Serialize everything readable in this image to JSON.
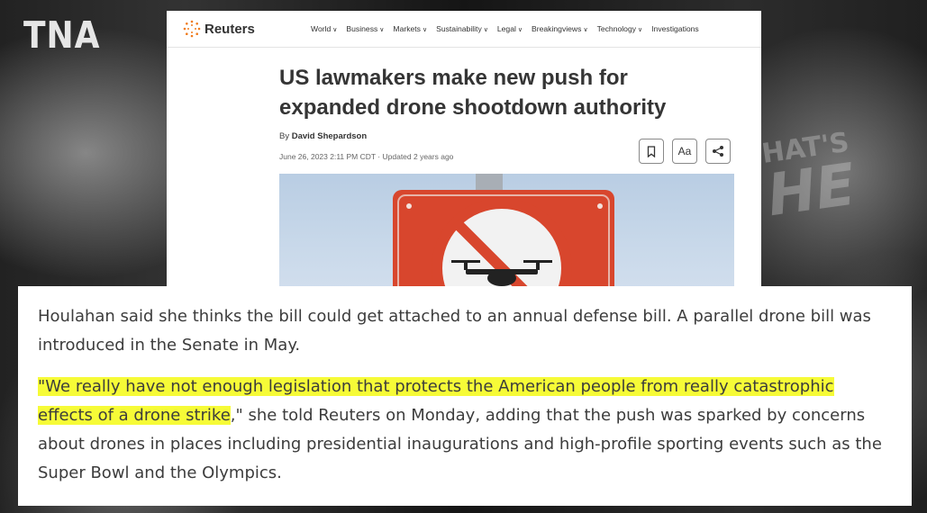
{
  "watermark": "TNA",
  "background_sign": {
    "line1": "HAT'S",
    "line2": "HE"
  },
  "reuters": {
    "logo": "Reuters",
    "nav": [
      {
        "label": "World",
        "has_dropdown": true
      },
      {
        "label": "Business",
        "has_dropdown": true
      },
      {
        "label": "Markets",
        "has_dropdown": true
      },
      {
        "label": "Sustainability",
        "has_dropdown": true
      },
      {
        "label": "Legal",
        "has_dropdown": true
      },
      {
        "label": "Breakingviews",
        "has_dropdown": true
      },
      {
        "label": "Technology",
        "has_dropdown": true
      },
      {
        "label": "Investigations",
        "has_dropdown": false
      }
    ],
    "headline": "US lawmakers make new push for expanded drone shootdown authority",
    "byline_prefix": "By",
    "author": "David Shepardson",
    "dateline": "June 26, 2023 2:11 PM CDT · Updated 2 years ago",
    "tools": {
      "bookmark_icon": "bookmark-icon",
      "text_size_label": "Aa",
      "share_icon": "share-icon"
    },
    "photo_icon": "no-drone-sign"
  },
  "quote": {
    "paragraph1": "Houlahan said she thinks the bill could get attached to an annual defense bill. A parallel drone bill was introduced in the Senate in May.",
    "highlighted": "\"We really have not enough legislation that protects the American people from really catastrophic effects of a drone strike",
    "rest": ",\" she told Reuters on Monday, adding that the push was sparked by concerns about drones in places including presidential inaugurations and high-profile sporting events such as the Super Bowl and the Olympics.",
    "highlight_color": "#f6fb37"
  },
  "colors": {
    "brand_orange": "#f07b1d",
    "sign_red": "#d8462d"
  }
}
